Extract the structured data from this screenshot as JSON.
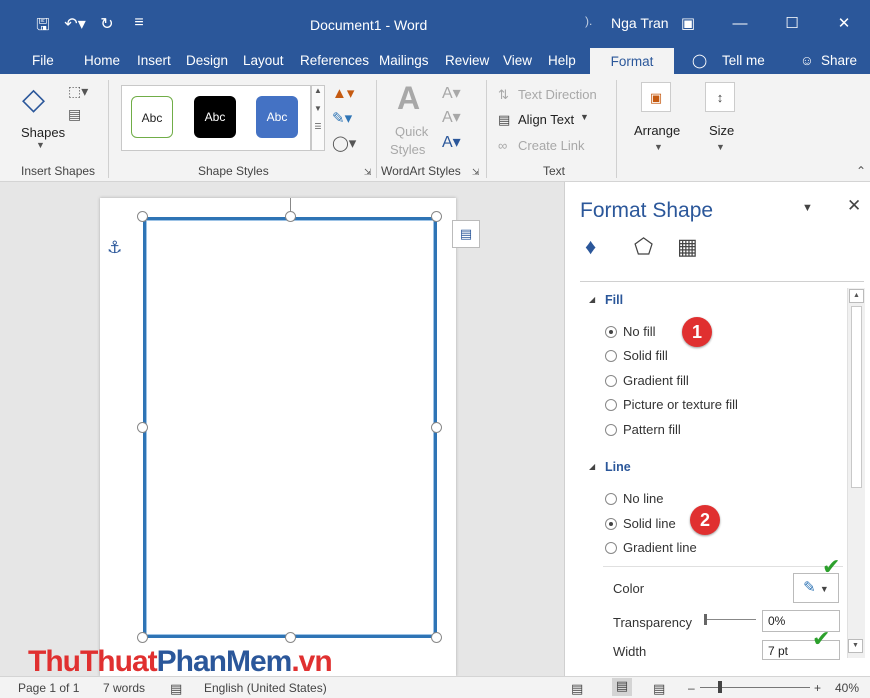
{
  "titlebar": {
    "document_title": "Document1 - Word",
    "user_mark": ").",
    "user_name": "Nga Tran"
  },
  "tabs": [
    "File",
    "Home",
    "Insert",
    "Design",
    "Layout",
    "References",
    "Mailings",
    "Review",
    "View",
    "Help",
    "Format",
    "Tell me",
    "Share"
  ],
  "ribbon": {
    "shapes_label": "Shapes",
    "insert_shapes_label": "Insert Shapes",
    "shape_styles_label": "Shape Styles",
    "style_samples": [
      "Abc",
      "Abc",
      "Abc"
    ],
    "quick_styles_label_1": "Quick",
    "quick_styles_label_2": "Styles",
    "wordart_styles_label": "WordArt Styles",
    "text_direction_label": "Text Direction",
    "align_text_label": "Align Text",
    "create_link_label": "Create Link",
    "text_group_label": "Text",
    "arrange_label": "Arrange",
    "size_label": "Size"
  },
  "pane": {
    "title": "Format Shape",
    "fill_section": "Fill",
    "fill_options": [
      "No fill",
      "Solid fill",
      "Gradient fill",
      "Picture or texture fill",
      "Pattern fill"
    ],
    "line_section": "Line",
    "line_options": [
      "No line",
      "Solid line",
      "Gradient line"
    ],
    "color_label": "Color",
    "transparency_label": "Transparency",
    "transparency_value": "0%",
    "width_label": "Width",
    "width_value": "7 pt",
    "badge_1": "1",
    "badge_2": "2"
  },
  "status": {
    "page": "Page 1 of 1",
    "words": "7 words",
    "language": "English (United States)",
    "zoom": "40%"
  },
  "watermark": {
    "part1": "ThuThuat",
    "part2": "PhanMem",
    "part3": ".vn"
  },
  "colors": {
    "word_blue": "#2b579a",
    "shape_outline": "#2e74b5",
    "badge_red": "#e03030",
    "check_green": "#2ca02c"
  }
}
